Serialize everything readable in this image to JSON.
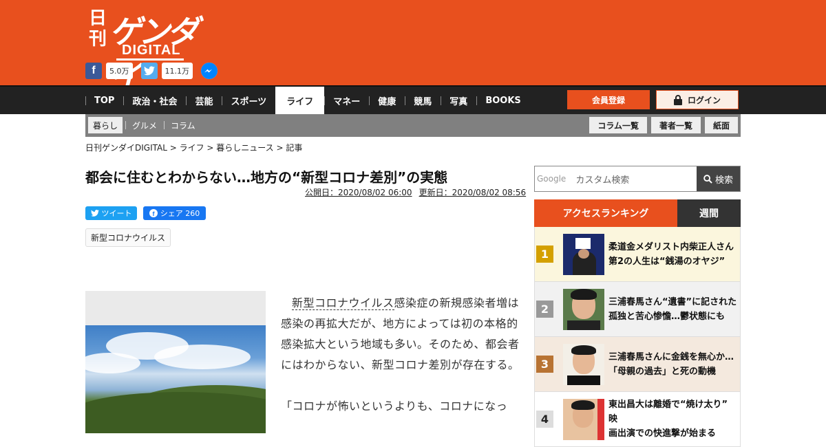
{
  "brand": {
    "kanji": "日刊",
    "name": "ゲンダイ",
    "sub": "DIGITAL"
  },
  "social": {
    "facebook_count": "5.0万",
    "twitter_count": "11.1万"
  },
  "nav": {
    "items": [
      "TOP",
      "政治・社会",
      "芸能",
      "スポーツ",
      "ライフ",
      "マネー",
      "健康",
      "競馬",
      "写真",
      "BOOKS"
    ],
    "active": "ライフ",
    "register": "会員登録",
    "login": "ログイン"
  },
  "subnav": {
    "items": [
      "暮らし",
      "グルメ",
      "コラム"
    ],
    "right": [
      "コラム一覧",
      "著者一覧",
      "紙面"
    ]
  },
  "breadcrumb": "日刊ゲンダイDIGITAL > ライフ > 暮らしニュース > 記事",
  "article": {
    "title": "都会に住むとわからない…地方の“新型コロナ差別”の実態",
    "published": "公開日：2020/08/02 06:00",
    "updated": "更新日：2020/08/02 08:56",
    "tweet": "ツイート",
    "share": "シェア 260",
    "tag": "新型コロナウイルス",
    "p1_link": "新型コロナウイルス",
    "p1_rest": "感染症の新規感染者増は感染の再拡大だが、地方によっては初の本格的感染拡大という地域も多い。そのため、都会者にはわからない、新型コロナ差別が存在する。",
    "p2": "「コロナが怖いというよりも、コロナになっ"
  },
  "search": {
    "google": "Google",
    "placeholder": "カスタム検索",
    "button": "検索"
  },
  "ranking": {
    "title": "アクセスランキング",
    "period": "週間",
    "items": [
      {
        "rank": "1",
        "color": "#d4a000",
        "bg": "#fbf6dd",
        "line1": "柔道金メダリスト内柴正人さん",
        "line2": "第2の人生は“銭湯のオヤジ”"
      },
      {
        "rank": "2",
        "color": "#999999",
        "bg": "#f1f1f1",
        "line1": "三浦春馬さん“遺書”に記された",
        "line2": "孤独と苦心惨憺…鬱状態にも"
      },
      {
        "rank": "3",
        "color": "#b87333",
        "bg": "#f4e9de",
        "line1": "三浦春馬さんに金銭を無心か…",
        "line2": "「母親の過去」と死の動機"
      },
      {
        "rank": "4",
        "color": "#dddddd",
        "bg": "#ffffff",
        "line1": "東出昌大は離婚で“焼け太り” 映",
        "line2": "画出演での快進撃が始まる"
      }
    ]
  }
}
